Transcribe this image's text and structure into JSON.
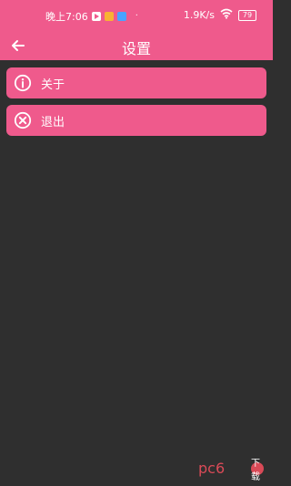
{
  "status_bar": {
    "time": "晚上7:06",
    "dot": "·",
    "network_speed": "1.9K/s",
    "battery": "79",
    "mini_apps": [
      {
        "icon": "video-app-icon",
        "color": "#ffffff"
      },
      {
        "icon": "photos-app-icon",
        "color": "#f9b233"
      },
      {
        "icon": "browser-app-icon",
        "color": "#4aa3ff"
      }
    ],
    "icons": [
      "wifi-icon",
      "battery-icon"
    ]
  },
  "header": {
    "title": "设置",
    "back_icon": "back-arrow-icon",
    "color": "#ef5a8c"
  },
  "settings": {
    "items": [
      {
        "label": "关于",
        "icon": "info-icon"
      },
      {
        "label": "退出",
        "icon": "close-circle-icon"
      }
    ]
  },
  "watermark": {
    "text": "pc6",
    "badge": "下载"
  },
  "theme": {
    "background": "#2f2f2f",
    "accent": "#ef5a8c"
  }
}
